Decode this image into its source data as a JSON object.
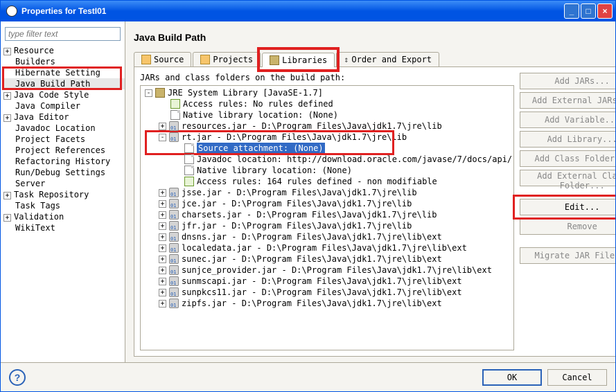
{
  "window": {
    "title": "Properties for TestI01"
  },
  "filter": {
    "placeholder": "type filter text"
  },
  "categories": [
    {
      "label": "Resource",
      "toggle": "+",
      "depth": 0
    },
    {
      "label": "Builders",
      "toggle": "",
      "depth": 0
    },
    {
      "label": "Hibernate Setting",
      "toggle": "",
      "depth": 0,
      "hl_top": true
    },
    {
      "label": "Java Build Path",
      "toggle": "",
      "depth": 0,
      "selected": true,
      "hl_bottom": true
    },
    {
      "label": "Java Code Style",
      "toggle": "+",
      "depth": 0
    },
    {
      "label": "Java Compiler",
      "toggle": "",
      "depth": 0
    },
    {
      "label": "Java Editor",
      "toggle": "+",
      "depth": 0
    },
    {
      "label": "Javadoc Location",
      "toggle": "",
      "depth": 0
    },
    {
      "label": "Project Facets",
      "toggle": "",
      "depth": 0
    },
    {
      "label": "Project References",
      "toggle": "",
      "depth": 0
    },
    {
      "label": "Refactoring History",
      "toggle": "",
      "depth": 0
    },
    {
      "label": "Run/Debug Settings",
      "toggle": "",
      "depth": 0
    },
    {
      "label": "Server",
      "toggle": "",
      "depth": 0
    },
    {
      "label": "Task Repository",
      "toggle": "+",
      "depth": 0
    },
    {
      "label": "Task Tags",
      "toggle": "",
      "depth": 0
    },
    {
      "label": "Validation",
      "toggle": "+",
      "depth": 0
    },
    {
      "label": "WikiText",
      "toggle": "",
      "depth": 0
    }
  ],
  "page": {
    "title": "Java Build Path"
  },
  "tabs": {
    "source": "Source",
    "projects": "Projects",
    "libraries": "Libraries",
    "order": "Order and Export",
    "desc": "JARs and class folders on the build path:"
  },
  "tree": [
    {
      "d": 0,
      "t": "-",
      "i": "lib",
      "label": "JRE System Library [JavaSE-1.7]"
    },
    {
      "d": 1,
      "t": "",
      "i": "rule",
      "label": "Access rules: No rules defined"
    },
    {
      "d": 1,
      "t": "",
      "i": "file",
      "label": "Native library location: (None)"
    },
    {
      "d": 1,
      "t": "+",
      "i": "jar",
      "label": "resources.jar - D:\\Program Files\\Java\\jdk1.7\\jre\\lib"
    },
    {
      "d": 1,
      "t": "-",
      "i": "jar",
      "label": "rt.jar - D:\\Program Files\\Java\\jdk1.7\\jre\\lib"
    },
    {
      "d": 2,
      "t": "",
      "i": "file",
      "label": "Source attachment: (None)",
      "sel": true
    },
    {
      "d": 2,
      "t": "",
      "i": "file",
      "label": "Javadoc location: http://download.oracle.com/javase/7/docs/api/"
    },
    {
      "d": 2,
      "t": "",
      "i": "file",
      "label": "Native library location: (None)"
    },
    {
      "d": 2,
      "t": "",
      "i": "rule",
      "label": "Access rules: 164 rules defined - non modifiable"
    },
    {
      "d": 1,
      "t": "+",
      "i": "jar",
      "label": "jsse.jar - D:\\Program Files\\Java\\jdk1.7\\jre\\lib"
    },
    {
      "d": 1,
      "t": "+",
      "i": "jar",
      "label": "jce.jar - D:\\Program Files\\Java\\jdk1.7\\jre\\lib"
    },
    {
      "d": 1,
      "t": "+",
      "i": "jar",
      "label": "charsets.jar - D:\\Program Files\\Java\\jdk1.7\\jre\\lib"
    },
    {
      "d": 1,
      "t": "+",
      "i": "jar",
      "label": "jfr.jar - D:\\Program Files\\Java\\jdk1.7\\jre\\lib"
    },
    {
      "d": 1,
      "t": "+",
      "i": "jar",
      "label": "dnsns.jar - D:\\Program Files\\Java\\jdk1.7\\jre\\lib\\ext"
    },
    {
      "d": 1,
      "t": "+",
      "i": "jar",
      "label": "localedata.jar - D:\\Program Files\\Java\\jdk1.7\\jre\\lib\\ext"
    },
    {
      "d": 1,
      "t": "+",
      "i": "jar",
      "label": "sunec.jar - D:\\Program Files\\Java\\jdk1.7\\jre\\lib\\ext"
    },
    {
      "d": 1,
      "t": "+",
      "i": "jar",
      "label": "sunjce_provider.jar - D:\\Program Files\\Java\\jdk1.7\\jre\\lib\\ext"
    },
    {
      "d": 1,
      "t": "+",
      "i": "jar",
      "label": "sunmscapi.jar - D:\\Program Files\\Java\\jdk1.7\\jre\\lib\\ext"
    },
    {
      "d": 1,
      "t": "+",
      "i": "jar",
      "label": "sunpkcs11.jar - D:\\Program Files\\Java\\jdk1.7\\jre\\lib\\ext"
    },
    {
      "d": 1,
      "t": "+",
      "i": "jar",
      "label": "zipfs.jar - D:\\Program Files\\Java\\jdk1.7\\jre\\lib\\ext"
    }
  ],
  "buttons": {
    "add_jars": "Add JARs...",
    "add_ext_jars": "Add External JARs...",
    "add_var": "Add Variable...",
    "add_lib": "Add Library...",
    "add_class_folder": "Add Class Folder...",
    "add_ext_class_folder": "Add External Class Folder...",
    "edit": "Edit...",
    "remove": "Remove",
    "migrate": "Migrate JAR File..."
  },
  "footer": {
    "ok": "OK",
    "cancel": "Cancel"
  }
}
